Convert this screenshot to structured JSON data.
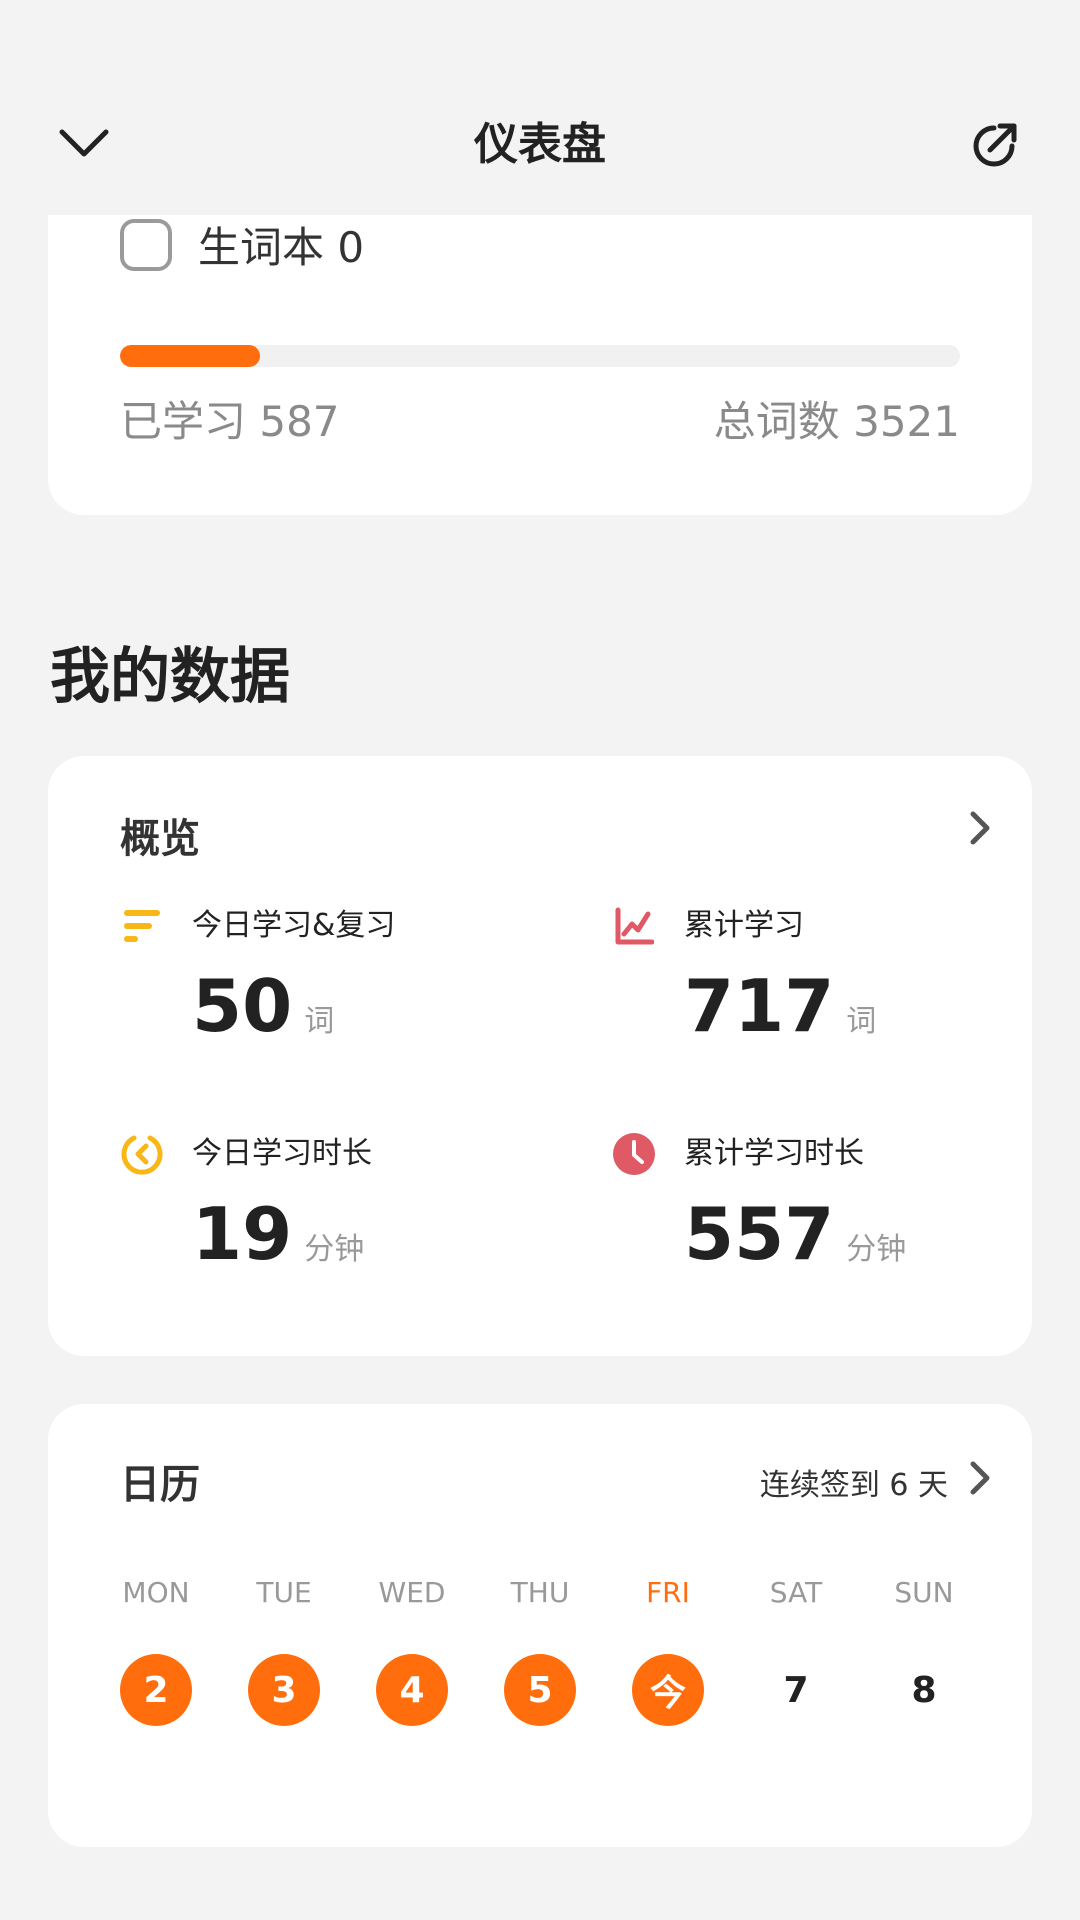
{
  "header": {
    "title": "仪表盘",
    "back_icon": "chevron-down-icon",
    "share_icon": "share-arrow-icon"
  },
  "word_book": {
    "checkbox_label": "生词本 0",
    "checked": false
  },
  "progress": {
    "learned_label": "已学习 587",
    "total_label": "总词数 3521",
    "learned": 587,
    "total": 3521
  },
  "my_data": {
    "title": "我的数据"
  },
  "overview": {
    "title": "概览",
    "stats": [
      {
        "label": "今日学习&复习",
        "value": "50",
        "unit": "词",
        "icon": "list-bars-icon",
        "color": "#f8b617"
      },
      {
        "label": "累计学习",
        "value": "717",
        "unit": "词",
        "icon": "line-chart-icon",
        "color": "#e05a65"
      },
      {
        "label": "今日学习时长",
        "value": "19",
        "unit": "分钟",
        "icon": "timer-arc-icon",
        "color": "#f8b617"
      },
      {
        "label": "累计学习时长",
        "value": "557",
        "unit": "分钟",
        "icon": "clock-icon",
        "color": "#e05a65"
      }
    ]
  },
  "calendar": {
    "title": "日历",
    "streak": "连续签到 6 天",
    "days": [
      {
        "label": "MON",
        "num": "2",
        "checked": true,
        "today": false
      },
      {
        "label": "TUE",
        "num": "3",
        "checked": true,
        "today": false
      },
      {
        "label": "WED",
        "num": "4",
        "checked": true,
        "today": false
      },
      {
        "label": "THU",
        "num": "5",
        "checked": true,
        "today": false
      },
      {
        "label": "FRI",
        "num": "今",
        "checked": true,
        "today": true
      },
      {
        "label": "SAT",
        "num": "7",
        "checked": false,
        "today": false
      },
      {
        "label": "SUN",
        "num": "8",
        "checked": false,
        "today": false
      }
    ]
  },
  "colors": {
    "accent": "#ff6d0c",
    "yellow": "#f8b617",
    "red": "#e05a65"
  }
}
